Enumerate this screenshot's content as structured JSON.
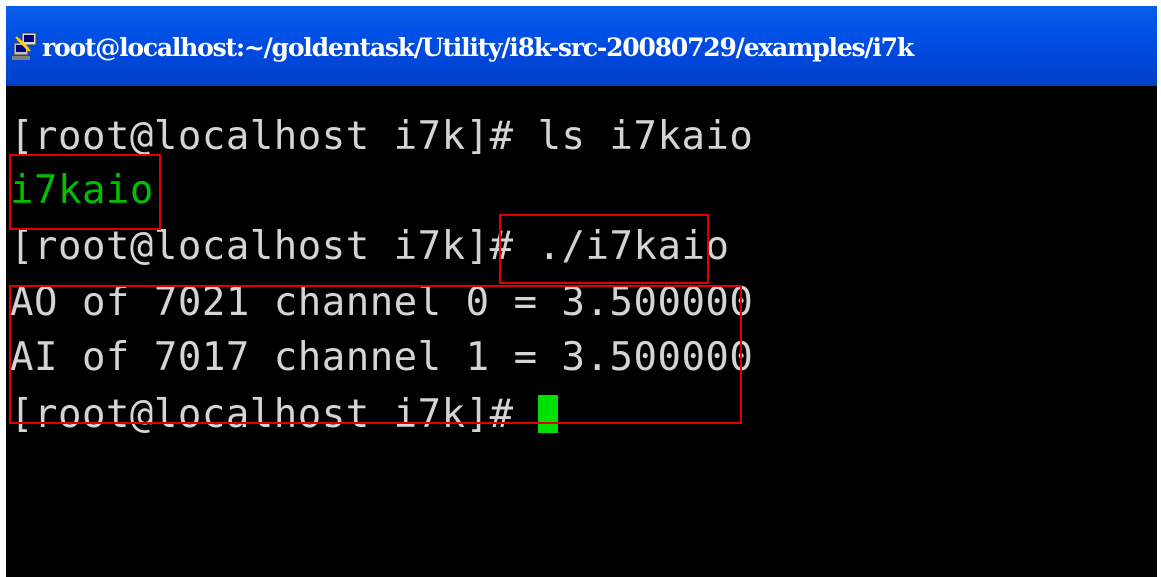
{
  "window": {
    "title": "root@localhost:~/goldentask/Utility/i8k-src-20080729/examples/i7k",
    "icon": "putty-terminal-icon"
  },
  "terminal": {
    "lines": [
      {
        "prompt": "[root@localhost i7k]#",
        "command": " ls i7kaio"
      },
      {
        "output": "i7kaio"
      },
      {
        "prompt": "[root@localhost i7k]#",
        "command": "./i7kaio"
      },
      {
        "output": "AO of 7021 channel 0 = 3.500000"
      },
      {
        "output": "AI of 7017 channel 1 = 3.500000"
      },
      {
        "prompt": "[root@localhost i7k]#"
      }
    ]
  },
  "colors": {
    "titlebar": "#0050e6",
    "background": "#000000",
    "text": "#d4d4d4",
    "executable": "#00c000",
    "cursor": "#00e000",
    "highlight": "#e00000"
  }
}
